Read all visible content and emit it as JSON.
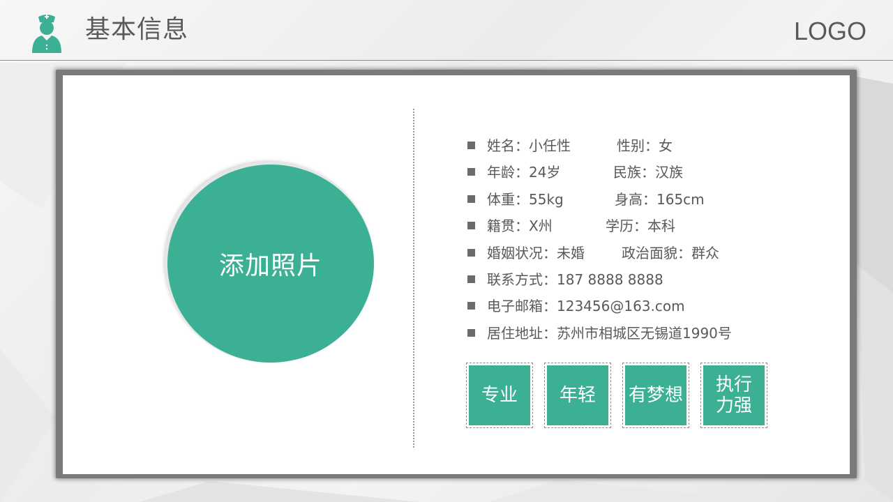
{
  "header": {
    "title": "基本信息",
    "logo": "LOGO"
  },
  "photo": {
    "label": "添加照片"
  },
  "info": [
    {
      "a": "姓名：小任性",
      "b": "性别：女"
    },
    {
      "a": "年龄：24岁",
      "b": "民族：汉族"
    },
    {
      "a": "体重：55kg",
      "b": "身高：165cm"
    },
    {
      "a": "籍贯：X州",
      "b": "学历：本科"
    },
    {
      "a": "婚姻状况：未婚",
      "b": "政治面貌：群众"
    },
    {
      "a": "联系方式：187 8888 8888",
      "b": ""
    },
    {
      "a": "电子邮箱：123456@163.com",
      "b": ""
    },
    {
      "a": "居住地址：苏州市相城区无锡道1990号",
      "b": ""
    }
  ],
  "tags": [
    "专业",
    "年轻",
    "有梦想",
    "执行力强"
  ],
  "colors": {
    "accent": "#3cb094",
    "text": "#595959",
    "bullet": "#6b6b6b"
  },
  "icons": {
    "header": "nurse-icon"
  }
}
